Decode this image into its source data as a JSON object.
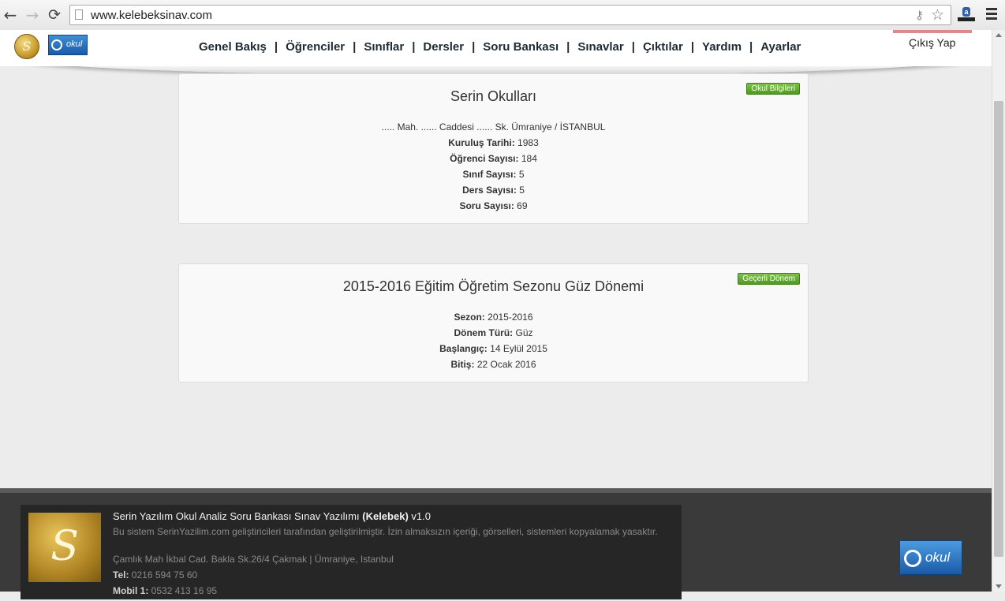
{
  "browser": {
    "url": "www.kelebeksinav.com",
    "back_glyph": "←",
    "forward_glyph": "→",
    "reload_glyph": "⟳",
    "key_glyph": "⚷",
    "star_glyph": "☆",
    "extension_glyph": "a"
  },
  "header": {
    "logo_glyph": "S",
    "eokul_logo_text": "okul",
    "nav": [
      "Genel Bakış",
      "Öğrenciler",
      "Sınıflar",
      "Dersler",
      "Soru Bankası",
      "Sınavlar",
      "Çıktılar",
      "Yardım",
      "Ayarlar"
    ],
    "nav_separator": "|",
    "logout_label": "Çıkış Yap"
  },
  "school_panel": {
    "title": "Serin Okulları",
    "button_label": "Okul Bilgileri",
    "address": "..... Mah. ...... Caddesi ...... Sk. Ümraniye / İSTANBUL",
    "rows": [
      {
        "label": "Kuruluş Tarihi:",
        "value": "1983"
      },
      {
        "label": "Öğrenci Sayısı:",
        "value": "184"
      },
      {
        "label": "Sınıf Sayısı:",
        "value": "5"
      },
      {
        "label": "Ders Sayısı:",
        "value": "5"
      },
      {
        "label": "Soru Sayısı:",
        "value": "69"
      }
    ]
  },
  "term_panel": {
    "title": "2015-2016 Eğitim Öğretim Sezonu Güz Dönemi",
    "button_label": "Geçerli Dönem",
    "rows": [
      {
        "label": "Sezon:",
        "value": "2015-2016"
      },
      {
        "label": "Dönem Türü:",
        "value": "Güz"
      },
      {
        "label": "Başlangıç:",
        "value": "14 Eylül 2015"
      },
      {
        "label": "Bitiş:",
        "value": "22 Ocak 2016"
      }
    ]
  },
  "footer": {
    "logo_glyph": "S",
    "title_prefix": "Serin Yazılım Okul Analiz Soru Bankası Sınav Yazılımı",
    "title_bold": "(Kelebek)",
    "title_version": "v1.0",
    "notice": "Bu sistem SerinYazilim.com geliştiricileri tarafından geliştirilmiştir. İzin almaksızın içeriği, görselleri, sistemleri kopyalamak yasaktır.",
    "address": "Çamlık Mah İkbal Cad. Bakla Sk.26/4 Çakmak | Ümraniye, Istanbul",
    "tel_label": "Tel:",
    "tel_value": "0216 594 75 60",
    "mobile_label": "Mobil 1:",
    "mobile_value": "0532 413 16 95",
    "eokul_logo_text": "okul"
  }
}
